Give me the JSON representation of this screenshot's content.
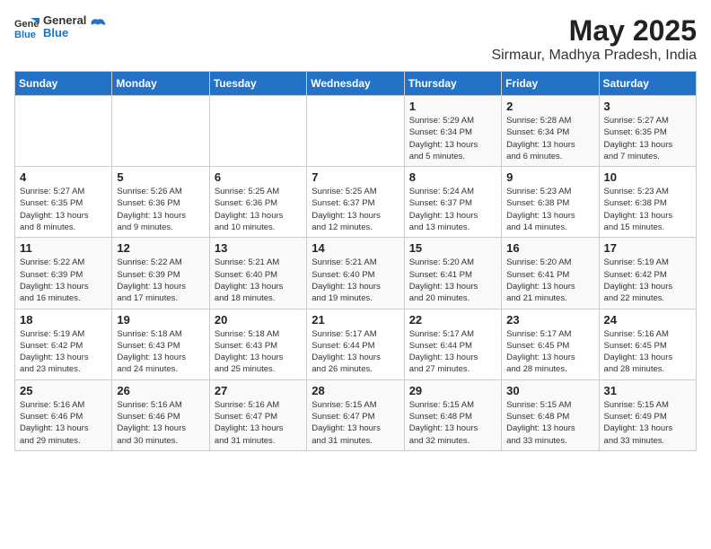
{
  "logo": {
    "general": "General",
    "blue": "Blue"
  },
  "title": "May 2025",
  "subtitle": "Sirmaur, Madhya Pradesh, India",
  "days_of_week": [
    "Sunday",
    "Monday",
    "Tuesday",
    "Wednesday",
    "Thursday",
    "Friday",
    "Saturday"
  ],
  "weeks": [
    [
      {
        "day": "",
        "detail": ""
      },
      {
        "day": "",
        "detail": ""
      },
      {
        "day": "",
        "detail": ""
      },
      {
        "day": "",
        "detail": ""
      },
      {
        "day": "1",
        "detail": "Sunrise: 5:29 AM\nSunset: 6:34 PM\nDaylight: 13 hours\nand 5 minutes."
      },
      {
        "day": "2",
        "detail": "Sunrise: 5:28 AM\nSunset: 6:34 PM\nDaylight: 13 hours\nand 6 minutes."
      },
      {
        "day": "3",
        "detail": "Sunrise: 5:27 AM\nSunset: 6:35 PM\nDaylight: 13 hours\nand 7 minutes."
      }
    ],
    [
      {
        "day": "4",
        "detail": "Sunrise: 5:27 AM\nSunset: 6:35 PM\nDaylight: 13 hours\nand 8 minutes."
      },
      {
        "day": "5",
        "detail": "Sunrise: 5:26 AM\nSunset: 6:36 PM\nDaylight: 13 hours\nand 9 minutes."
      },
      {
        "day": "6",
        "detail": "Sunrise: 5:25 AM\nSunset: 6:36 PM\nDaylight: 13 hours\nand 10 minutes."
      },
      {
        "day": "7",
        "detail": "Sunrise: 5:25 AM\nSunset: 6:37 PM\nDaylight: 13 hours\nand 12 minutes."
      },
      {
        "day": "8",
        "detail": "Sunrise: 5:24 AM\nSunset: 6:37 PM\nDaylight: 13 hours\nand 13 minutes."
      },
      {
        "day": "9",
        "detail": "Sunrise: 5:23 AM\nSunset: 6:38 PM\nDaylight: 13 hours\nand 14 minutes."
      },
      {
        "day": "10",
        "detail": "Sunrise: 5:23 AM\nSunset: 6:38 PM\nDaylight: 13 hours\nand 15 minutes."
      }
    ],
    [
      {
        "day": "11",
        "detail": "Sunrise: 5:22 AM\nSunset: 6:39 PM\nDaylight: 13 hours\nand 16 minutes."
      },
      {
        "day": "12",
        "detail": "Sunrise: 5:22 AM\nSunset: 6:39 PM\nDaylight: 13 hours\nand 17 minutes."
      },
      {
        "day": "13",
        "detail": "Sunrise: 5:21 AM\nSunset: 6:40 PM\nDaylight: 13 hours\nand 18 minutes."
      },
      {
        "day": "14",
        "detail": "Sunrise: 5:21 AM\nSunset: 6:40 PM\nDaylight: 13 hours\nand 19 minutes."
      },
      {
        "day": "15",
        "detail": "Sunrise: 5:20 AM\nSunset: 6:41 PM\nDaylight: 13 hours\nand 20 minutes."
      },
      {
        "day": "16",
        "detail": "Sunrise: 5:20 AM\nSunset: 6:41 PM\nDaylight: 13 hours\nand 21 minutes."
      },
      {
        "day": "17",
        "detail": "Sunrise: 5:19 AM\nSunset: 6:42 PM\nDaylight: 13 hours\nand 22 minutes."
      }
    ],
    [
      {
        "day": "18",
        "detail": "Sunrise: 5:19 AM\nSunset: 6:42 PM\nDaylight: 13 hours\nand 23 minutes."
      },
      {
        "day": "19",
        "detail": "Sunrise: 5:18 AM\nSunset: 6:43 PM\nDaylight: 13 hours\nand 24 minutes."
      },
      {
        "day": "20",
        "detail": "Sunrise: 5:18 AM\nSunset: 6:43 PM\nDaylight: 13 hours\nand 25 minutes."
      },
      {
        "day": "21",
        "detail": "Sunrise: 5:17 AM\nSunset: 6:44 PM\nDaylight: 13 hours\nand 26 minutes."
      },
      {
        "day": "22",
        "detail": "Sunrise: 5:17 AM\nSunset: 6:44 PM\nDaylight: 13 hours\nand 27 minutes."
      },
      {
        "day": "23",
        "detail": "Sunrise: 5:17 AM\nSunset: 6:45 PM\nDaylight: 13 hours\nand 28 minutes."
      },
      {
        "day": "24",
        "detail": "Sunrise: 5:16 AM\nSunset: 6:45 PM\nDaylight: 13 hours\nand 28 minutes."
      }
    ],
    [
      {
        "day": "25",
        "detail": "Sunrise: 5:16 AM\nSunset: 6:46 PM\nDaylight: 13 hours\nand 29 minutes."
      },
      {
        "day": "26",
        "detail": "Sunrise: 5:16 AM\nSunset: 6:46 PM\nDaylight: 13 hours\nand 30 minutes."
      },
      {
        "day": "27",
        "detail": "Sunrise: 5:16 AM\nSunset: 6:47 PM\nDaylight: 13 hours\nand 31 minutes."
      },
      {
        "day": "28",
        "detail": "Sunrise: 5:15 AM\nSunset: 6:47 PM\nDaylight: 13 hours\nand 31 minutes."
      },
      {
        "day": "29",
        "detail": "Sunrise: 5:15 AM\nSunset: 6:48 PM\nDaylight: 13 hours\nand 32 minutes."
      },
      {
        "day": "30",
        "detail": "Sunrise: 5:15 AM\nSunset: 6:48 PM\nDaylight: 13 hours\nand 33 minutes."
      },
      {
        "day": "31",
        "detail": "Sunrise: 5:15 AM\nSunset: 6:49 PM\nDaylight: 13 hours\nand 33 minutes."
      }
    ]
  ]
}
